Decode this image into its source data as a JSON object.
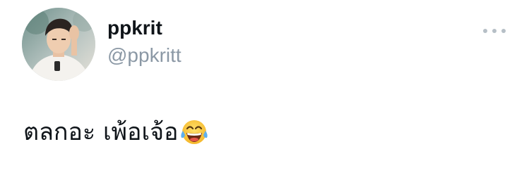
{
  "tweet": {
    "author_name": "ppkrit",
    "author_handle": "@ppkritt",
    "text": "ตลกอะ เพ้อเจ้อ",
    "emoji": "face-with-tears-of-joy",
    "more_icon": "more-horizontal-icon"
  },
  "colors": {
    "text_primary": "#0f1419",
    "text_secondary": "#8b98a5",
    "dots": "#b6bfc6"
  }
}
